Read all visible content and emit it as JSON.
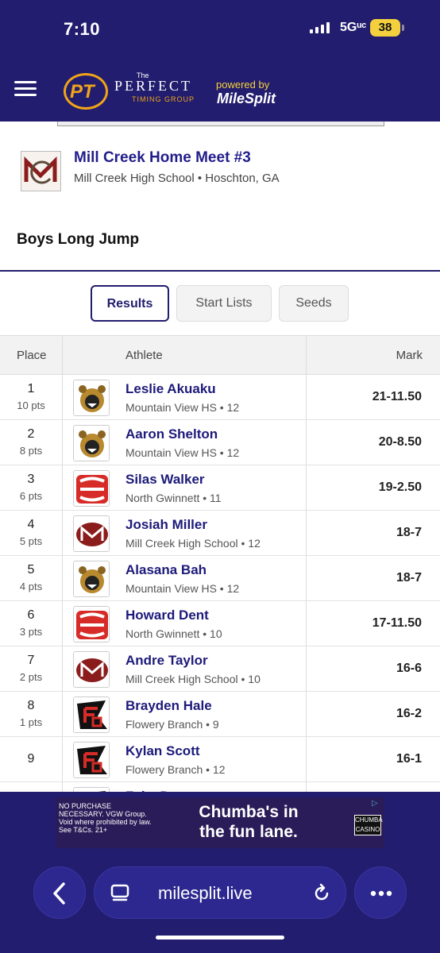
{
  "status": {
    "time": "7:10",
    "network": "5Gᵘᶜ",
    "battery": "38"
  },
  "header": {
    "logo_the": "The",
    "logo_pt": "PT",
    "logo_perfect": "PERFECT",
    "logo_timing": "TIMING GROUP",
    "powered_by": "powered by",
    "milesplit": "MileSplit"
  },
  "meet": {
    "title": "Mill Creek Home Meet #3",
    "subtitle": "Mill Creek High School • Hoschton, GA",
    "event": "Boys Long Jump"
  },
  "tabs": [
    {
      "label": "Results",
      "active": true
    },
    {
      "label": "Start Lists",
      "active": false
    },
    {
      "label": "Seeds",
      "active": false
    }
  ],
  "table": {
    "headers": {
      "place": "Place",
      "athlete": "Athlete",
      "mark": "Mark"
    },
    "rows": [
      {
        "place": "1",
        "pts": "10 pts",
        "name": "Leslie Akuaku",
        "school": "Mountain View HS • 12",
        "mark": "21-11.50",
        "team": "bear"
      },
      {
        "place": "2",
        "pts": "8 pts",
        "name": "Aaron Shelton",
        "school": "Mountain View HS • 12",
        "mark": "20-8.50",
        "team": "bear"
      },
      {
        "place": "3",
        "pts": "6 pts",
        "name": "Silas Walker",
        "school": "North Gwinnett • 11",
        "mark": "19-2.50",
        "team": "ng"
      },
      {
        "place": "4",
        "pts": "5 pts",
        "name": "Josiah Miller",
        "school": "Mill Creek High School • 12",
        "mark": "18-7",
        "team": "mc"
      },
      {
        "place": "5",
        "pts": "4 pts",
        "name": "Alasana Bah",
        "school": "Mountain View HS • 12",
        "mark": "18-7",
        "team": "bear"
      },
      {
        "place": "6",
        "pts": "3 pts",
        "name": "Howard Dent",
        "school": "North Gwinnett • 10",
        "mark": "17-11.50",
        "team": "ng"
      },
      {
        "place": "7",
        "pts": "2 pts",
        "name": "Andre Taylor",
        "school": "Mill Creek High School • 10",
        "mark": "16-6",
        "team": "mc"
      },
      {
        "place": "8",
        "pts": "1 pts",
        "name": "Brayden Hale",
        "school": "Flowery Branch • 9",
        "mark": "16-2",
        "team": "fb"
      },
      {
        "place": "9",
        "pts": "",
        "name": "Kylan Scott",
        "school": "Flowery Branch • 12",
        "mark": "16-1",
        "team": "fb"
      },
      {
        "place": "",
        "pts": "",
        "name": "Zeke Doron",
        "school": "",
        "mark": "",
        "team": "fb"
      }
    ]
  },
  "ad": {
    "small_text": "NO PURCHASE NECESSARY. VGW Group. Void where prohibited by law. See T&Cs. 21+",
    "headline_1": "Chumba's in",
    "headline_2": "the fun lane.",
    "brand": "CHUMBA CASINO"
  },
  "browser": {
    "url": "milesplit.live"
  }
}
